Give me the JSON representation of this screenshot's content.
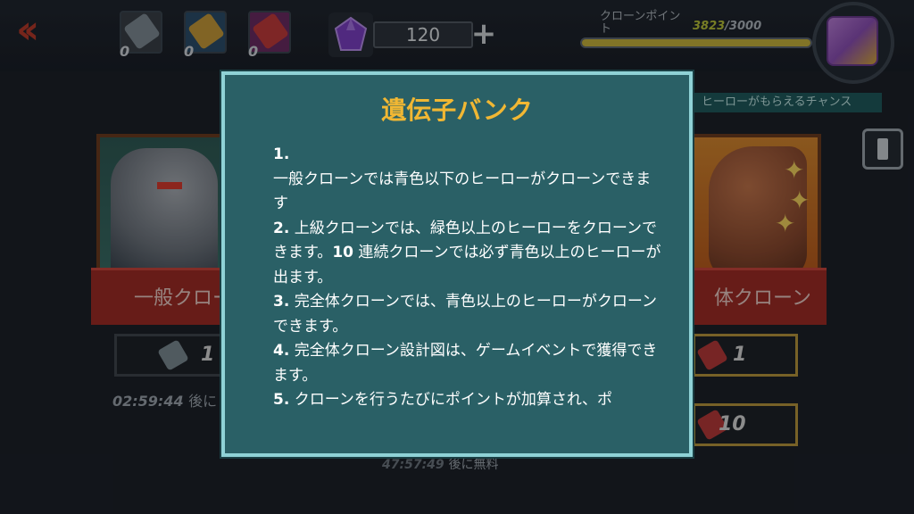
{
  "top_bar": {
    "back_icon": "double-chevron-left-icon",
    "resources": [
      {
        "icon": "scroll-icon",
        "count": "0"
      },
      {
        "icon": "gold-scroll-icon",
        "count": "0"
      },
      {
        "icon": "red-scroll-icon",
        "count": "0"
      }
    ],
    "gems": {
      "icon": "purple-gem-icon",
      "value": "120",
      "plus_label": "+"
    },
    "clone_points": {
      "label": "クローンポイント",
      "current": "3823",
      "max": "/3000",
      "progress": 1.0
    },
    "chance_banner": "ヒーローがもらえるチャンス",
    "colors": {
      "accent": "#c7b33c",
      "bar_border": "#5b6470"
    }
  },
  "cards": {
    "left": {
      "ribbon_label": "一般クロー",
      "cost": "1",
      "timer": "02:59:44",
      "timer_suffix": "後に"
    },
    "right": {
      "ribbon_label": "体クローン",
      "cost_1": "1",
      "cost_10": "10"
    },
    "bottom_timer": "47:57:49",
    "bottom_timer_suffix": "後に無料"
  },
  "modal": {
    "title": "遺伝子バンク",
    "items": [
      {
        "num": "1.",
        "text": ""
      },
      {
        "num": "",
        "text": "一般クローンでは青色以下のヒーローがクローンできます"
      },
      {
        "num": "2.",
        "text": " 上級クローンでは、緑色以上のヒーローをクローンできます。"
      },
      {
        "num": "10",
        "text": " 連続クローンでは必ず青色以上のヒーローが出ます。"
      },
      {
        "num": "3.",
        "text": " 完全体クローンでは、青色以上のヒーローがクローンできます。"
      },
      {
        "num": "4.",
        "text": " 完全体クローン設計図は、ゲームイベントで獲得できます。"
      },
      {
        "num": "5.",
        "text": " クローンを行うたびにポイントが加算され、ポ"
      }
    ],
    "colors": {
      "panel": "#2a6066",
      "border": "#8fd2d6",
      "title": "#f1b733"
    }
  }
}
